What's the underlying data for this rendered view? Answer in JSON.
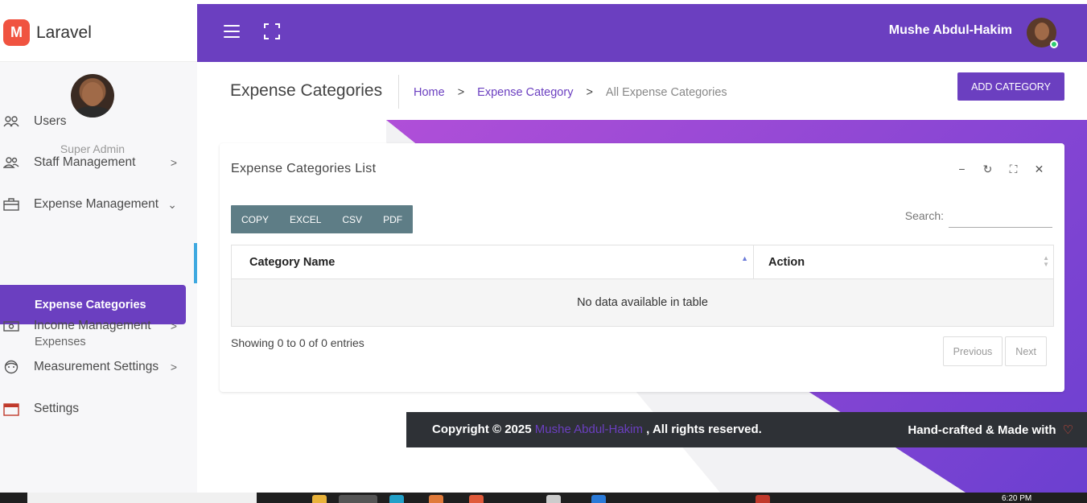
{
  "brand": {
    "logo_letter": "M",
    "name": "Laravel"
  },
  "sidebar": {
    "role": "Super Admin",
    "items": [
      {
        "label": "Users",
        "icon": "users-icon",
        "has_chevron": false
      },
      {
        "label": "Staff Management",
        "icon": "staff-icon",
        "chevron": ">"
      },
      {
        "label": "Expense Management",
        "icon": "briefcase-icon",
        "chevron": "⌄"
      },
      {
        "label": "Income Management",
        "icon": "money-icon",
        "chevron": ">"
      },
      {
        "label": "Measurement Settings",
        "icon": "face-icon",
        "chevron": ">"
      },
      {
        "label": "Settings",
        "icon": "calendar-icon",
        "has_chevron": false
      }
    ],
    "sub_items": [
      {
        "label": "Expense Categories",
        "active": true
      },
      {
        "label": "Expenses",
        "active": false
      }
    ]
  },
  "header": {
    "user_name": "Mushe Abdul-Hakim"
  },
  "page": {
    "title": "Expense Categories",
    "breadcrumb": [
      {
        "label": "Home"
      },
      {
        "label": "Expense Category"
      },
      {
        "label": "All Expense Categories"
      }
    ],
    "breadcrumb_sep": ">",
    "add_button": "ADD CATEGORY"
  },
  "card": {
    "title": "Expense Categories List",
    "tools": [
      "−",
      "↻",
      "⛶",
      "✕"
    ],
    "export_buttons": [
      "COPY",
      "EXCEL",
      "CSV",
      "PDF"
    ],
    "search_label": "Search:",
    "search_value": "",
    "columns": [
      "Category Name",
      "Action"
    ],
    "empty_message": "No data available in table",
    "info": "Showing 0 to 0 of 0 entries",
    "pager": {
      "previous": "Previous",
      "next": "Next"
    }
  },
  "footer": {
    "copyright_prefix": "Copyright © 2025",
    "owner": "Mushe Abdul-Hakim",
    "suffix": ", All rights reserved.",
    "right_text": "Hand-crafted & Made with",
    "heart": "♡"
  },
  "taskbar": {
    "time": "6:20 PM"
  },
  "colors": {
    "primary": "#6b3fc0",
    "accent_bar": "#3fa9e0",
    "footer_bg": "#2e3136",
    "logo": "#f05340"
  }
}
